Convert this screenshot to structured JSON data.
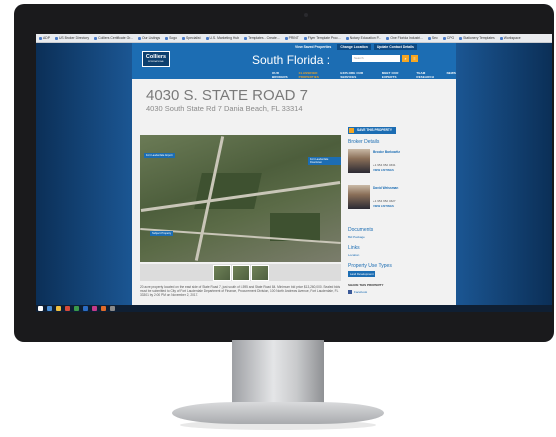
{
  "bookmarks": [
    {
      "label": "ADP"
    },
    {
      "label": "US Broker Directory"
    },
    {
      "label": "Colliers Certificate Gr..."
    },
    {
      "label": "Our Listings"
    },
    {
      "label": "Sogo"
    },
    {
      "label": "Specialist"
    },
    {
      "label": "U.S. Marketing Hub"
    },
    {
      "label": "Templates - Create..."
    },
    {
      "label": "PRINT"
    },
    {
      "label": "Flyer Template Proc..."
    },
    {
      "label": "Notary Education P..."
    },
    {
      "label": "One Florida Industri..."
    },
    {
      "label": "Sec"
    },
    {
      "label": "CPG"
    },
    {
      "label": "Stationery Templates"
    },
    {
      "label": "Workspace"
    }
  ],
  "site": {
    "logo_main": "Colliers",
    "logo_sub": "INTERNATIONAL",
    "region": "South Florida :",
    "top_links": [
      "View Saved Properties",
      "Change Location",
      "Update Contact Details"
    ],
    "search_placeholder": "Search",
    "nav": [
      "OUR BROKERS",
      "CLASSIFIED PROPERTIES",
      "EXPLORE OUR SERVICES",
      "MEET OUR EXPERTS",
      "TEAM RESEARCH",
      "NEWS"
    ]
  },
  "property": {
    "title": "4030 S. STATE ROAD 7",
    "address": "4030 South State Rd 7 Dania Beach, FL 33314",
    "pin_labels": [
      "Fort Lauderdale Airport",
      "Fort Lauderdale Downtown",
      "Subject Property"
    ],
    "description": "20 acre property located on the east side of State Road 7, just south of I-595 and State Road 84. Minimum bid price $13,260,000. Sealed bids must be submitted to City of Fort Lauderdale Department of Finance, Procurement Division, 100 North Andrews Avenue, Fort Lauderdale, FL 33301 by 2:00 PM on November 2, 2017."
  },
  "sidebar": {
    "save_label": "SAVE THIS PROPERTY",
    "broker_heading": "Broker Details",
    "brokers": [
      {
        "name": "Brooke Barkowitz",
        "phone": "+1 954 652 4631",
        "link": "VIEW LISTINGS"
      },
      {
        "name": "David Weissman",
        "phone": "+1 954 652 4627",
        "link": "VIEW LISTINGS"
      }
    ],
    "documents_heading": "Documents",
    "documents_item": "Bid Package",
    "links_heading": "Links",
    "links_item": "Location",
    "use_types_heading": "Property Use Types",
    "use_type_tag": "Land Development",
    "share_heading": "SHARE THIS PROPERTY",
    "share_item": "Facebook"
  },
  "colors": {
    "brand_blue": "#1c6db3",
    "accent_orange": "#f5a623",
    "page_bg": "#f2f2f2"
  }
}
